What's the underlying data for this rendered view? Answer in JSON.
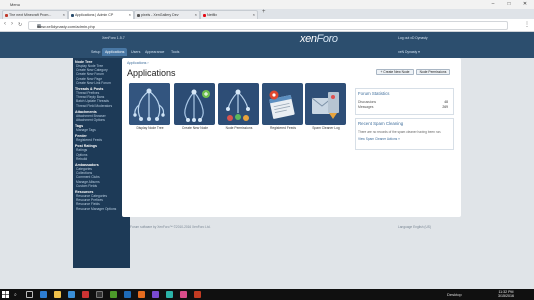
{
  "window": {
    "menu_label": "Menu"
  },
  "tabs": [
    {
      "label": "The next Minecraft Prom...",
      "color": "#c0392b"
    },
    {
      "label": "Applications | Admin CP",
      "color": "#2c4e6e"
    },
    {
      "label": "pixels - XenGallery Dev",
      "color": "#555555"
    },
    {
      "label": "Netflix",
      "color": "#e50914"
    }
  ],
  "address": {
    "url": "www.xe5dynasty.com/admin.php"
  },
  "header": {
    "version": "XenForo 1.5.7",
    "logo_a": "xen",
    "logo_b": "Foro",
    "user_link": "Log out xD Dynasty",
    "user_sub": "xeN Dynasty ▾"
  },
  "nav": [
    "Setup",
    "Applications",
    "Users",
    "Appearance",
    "Tools"
  ],
  "sidebar": [
    {
      "title": "Node Tree",
      "items": [
        "Display Node Tree",
        "Create New Category",
        "Create New Forum",
        "Create New Page",
        "Create New Link Forum"
      ]
    },
    {
      "title": "Threads & Posts",
      "items": [
        "Thread Prefixes",
        "Thread Reply Bans",
        "Batch Update Threads",
        "Thread Field Moderators"
      ]
    },
    {
      "title": "Attachments",
      "items": [
        "Attachment Browser",
        "Attachment Options"
      ]
    },
    {
      "title": "Tags",
      "items": [
        "Manage Tags"
      ]
    },
    {
      "title": "Feeder",
      "items": [
        "Registered Feeds"
      ]
    },
    {
      "title": "Post Ratings",
      "items": [
        "Ratings",
        "Options",
        "Rebuild"
      ]
    },
    {
      "title": "Ambassadors",
      "items": [
        "Categories",
        "Collections",
        "Comment Clubs",
        "Manage Albums",
        "Custom Fields"
      ]
    },
    {
      "title": "Resources",
      "items": [
        "Resource Categories",
        "Resource Prefixes",
        "Resource Fields",
        "Resource Manager Options"
      ]
    }
  ],
  "main": {
    "breadcrumb": "Applications ›",
    "title": "Applications",
    "btn_create": "+ Create New Node",
    "btn_perm": "Node Permissions",
    "tiles": [
      {
        "label": "Display Node Tree",
        "icon": "node-tree-icon"
      },
      {
        "label": "Create New Node",
        "icon": "create-node-icon"
      },
      {
        "label": "Node Permissions",
        "icon": "node-permissions-icon"
      },
      {
        "label": "Registered Feeds",
        "icon": "feeds-icon"
      },
      {
        "label": "Spam Cleaner Log",
        "icon": "spam-cleaner-icon"
      }
    ],
    "stats": {
      "title": "Forum Statistics",
      "rows": [
        {
          "k": "Discussions",
          "v": "48"
        },
        {
          "k": "Messages",
          "v": "269"
        }
      ]
    },
    "spam": {
      "title": "Recent Spam Cleaning",
      "text": "There are no records of the spam cleaner having been run.",
      "link": "View Spam Cleaner Actions »"
    }
  },
  "footer": {
    "left": "Forum software by XenForo™ ©2010-2016 XenForo Ltd.",
    "right": "Language English (US)"
  },
  "taskbar": {
    "desktop": "Desktop",
    "time": "11:32 PM",
    "date": "3/15/2016"
  }
}
